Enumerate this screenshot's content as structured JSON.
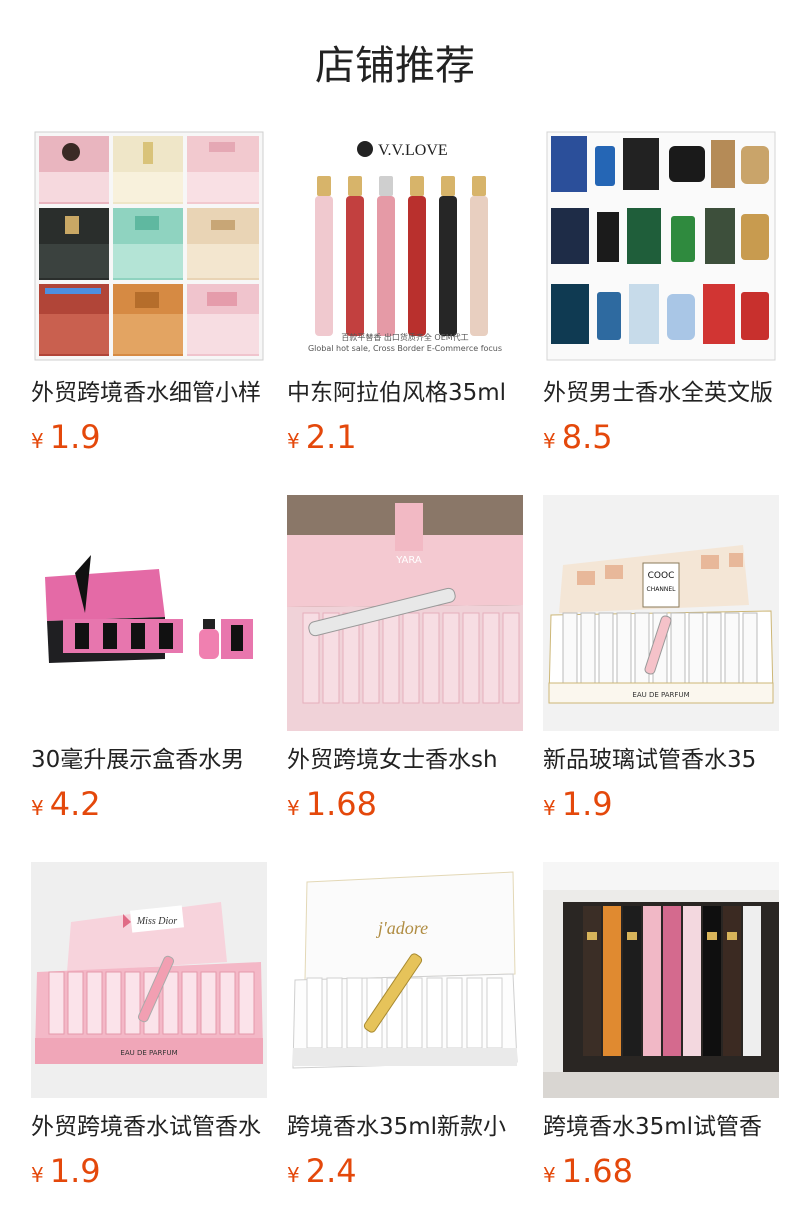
{
  "header": {
    "title": "店铺推荐"
  },
  "products": [
    {
      "name": "外贸跨境香水细管小样",
      "currency": "¥",
      "price": "1.9",
      "image_text": []
    },
    {
      "name": "中东阿拉伯风格35ml",
      "currency": "¥",
      "price": "2.1",
      "image_text": [
        "V.V.LOVE",
        "百款平替香 出口货质齐全 OEM代工",
        "Global hot sale, Cross Border E-Commerce focus"
      ]
    },
    {
      "name": "外贸男士香水全英文版",
      "currency": "¥",
      "price": "8.5",
      "image_text": []
    },
    {
      "name": "30毫升展示盒香水男",
      "currency": "¥",
      "price": "4.2",
      "image_text": []
    },
    {
      "name": "外贸跨境女士香水sh",
      "currency": "¥",
      "price": "1.68",
      "image_text": [
        "YARA"
      ]
    },
    {
      "name": "新品玻璃试管香水35",
      "currency": "¥",
      "price": "1.9",
      "image_text": [
        "COOC",
        "CHANNEL",
        "EAU DE PARFUM"
      ]
    },
    {
      "name": "外贸跨境香水试管香水",
      "currency": "¥",
      "price": "1.9",
      "image_text": [
        "Miss Dior",
        "EAU DE PARFUM"
      ]
    },
    {
      "name": "跨境香水35ml新款小",
      "currency": "¥",
      "price": "2.4",
      "image_text": [
        "j'adore"
      ]
    },
    {
      "name": "跨境香水35ml试管香",
      "currency": "¥",
      "price": "1.68",
      "image_text": []
    }
  ],
  "colors": {
    "price": "#e4480b",
    "text": "#222222",
    "background": "#ffffff"
  }
}
